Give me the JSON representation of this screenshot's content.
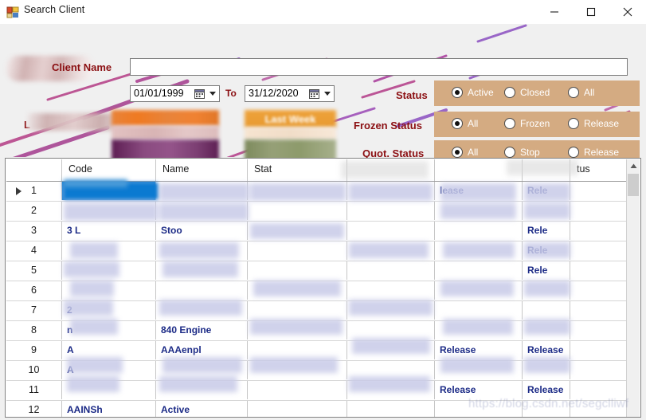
{
  "window": {
    "title": "Search Client",
    "icon": "application-window-icon",
    "minimize_label": "—",
    "maximize_label": "□",
    "close_label": "✕"
  },
  "form": {
    "client_name_label": "Client Name",
    "client_name_value": "",
    "client_name_placeholder": "",
    "date_from": "01/01/1999",
    "date_to": "31/12/2020",
    "to_label": "To",
    "redacted_left_label": "L",
    "last_week_button": "Last Week",
    "status": {
      "label": "Status",
      "options": [
        {
          "label": "Active",
          "selected": true
        },
        {
          "label": "Closed",
          "selected": false
        },
        {
          "label": "All",
          "selected": false
        }
      ]
    },
    "frozen_status": {
      "label": "Frozen Status",
      "options": [
        {
          "label": "All",
          "selected": true
        },
        {
          "label": "Frozen",
          "selected": false
        },
        {
          "label": "Release",
          "selected": false
        }
      ]
    },
    "quot_status": {
      "label": "Quot. Status",
      "options": [
        {
          "label": "All",
          "selected": true
        },
        {
          "label": "Stop",
          "selected": false
        },
        {
          "label": "Release",
          "selected": false
        }
      ]
    }
  },
  "grid": {
    "columns": [
      {
        "key": "rownum",
        "label": ""
      },
      {
        "key": "code",
        "label": "Code"
      },
      {
        "key": "name",
        "label": "Name"
      },
      {
        "key": "status",
        "label": "Stat"
      },
      {
        "key": "col4",
        "label": ""
      },
      {
        "key": "col5",
        "label": ""
      },
      {
        "key": "col6",
        "label": ""
      },
      {
        "key": "col7",
        "label": "tus"
      }
    ],
    "rows": [
      {
        "n": "1",
        "code": "",
        "name": "",
        "frozen": "lease",
        "quot": "Rele",
        "selected": true
      },
      {
        "n": "2",
        "code": "",
        "name": "",
        "frozen": "",
        "quot": ""
      },
      {
        "n": "3",
        "code": "3      L",
        "name": "Stoo",
        "frozen": "",
        "quot": "Rele"
      },
      {
        "n": "4",
        "code": "",
        "name": "",
        "frozen": "",
        "quot": "Rele"
      },
      {
        "n": "5",
        "code": "",
        "name": "",
        "frozen": "",
        "quot": "Rele"
      },
      {
        "n": "6",
        "code": "",
        "name": "",
        "frozen": "",
        "quot": ""
      },
      {
        "n": "7",
        "code": "2",
        "name": "",
        "frozen": "",
        "quot": ""
      },
      {
        "n": "8",
        "code": "n",
        "name": "840 Engine",
        "frozen": "",
        "quot": ""
      },
      {
        "n": "9",
        "code": "A",
        "name": "AAAenpl",
        "frozen": "Release",
        "quot": "Release"
      },
      {
        "n": "10",
        "code": "A",
        "name": "",
        "frozen": "",
        "quot": ""
      },
      {
        "n": "11",
        "code": "",
        "name": "",
        "frozen": "Release",
        "quot": "Release"
      },
      {
        "n": "12",
        "code": "AAINSh",
        "name": "Active",
        "frozen": "",
        "quot": ""
      }
    ],
    "scrollbar": {
      "up_arrow": "▲"
    }
  },
  "watermark": "https://blog.csdn.net/segclliwf",
  "colors": {
    "panel_tan": "#d4ab82",
    "label_red": "#8b0f12",
    "grid_text_blue": "#1b2a86",
    "selection_blue": "#0b7ad1",
    "form_background": "#f0f0f0"
  }
}
